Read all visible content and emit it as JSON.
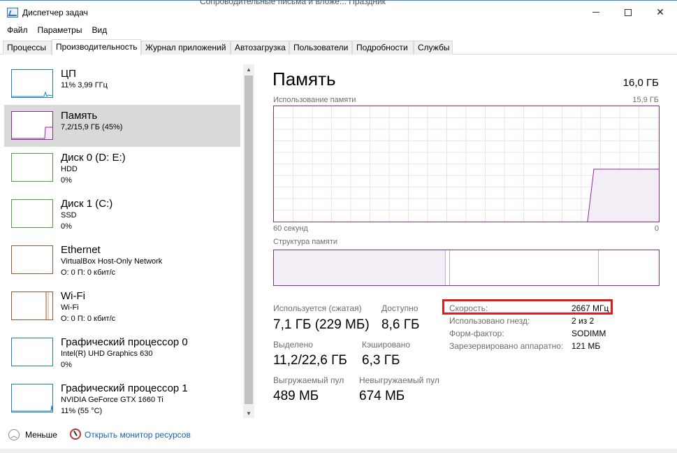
{
  "window": {
    "title": "Диспетчер задач",
    "background_text": "Сопроводительные письма и вложе...   Праздник"
  },
  "menu": [
    "Файл",
    "Параметры",
    "Вид"
  ],
  "tabs": [
    "Процессы",
    "Производительность",
    "Журнал приложений",
    "Автозагрузка",
    "Пользователи",
    "Подробности",
    "Службы"
  ],
  "active_tab": "Производительность",
  "sidebar": {
    "items": [
      {
        "name": "ЦП",
        "line2": "11% 3,99 ГГц",
        "line3": "",
        "color": "#1a7fbf"
      },
      {
        "name": "Память",
        "line2": "7,2/15,9 ГБ (45%)",
        "line3": "",
        "color": "#8b2a9a"
      },
      {
        "name": "Диск 0 (D: E:)",
        "line2": "HDD",
        "line3": "0%",
        "color": "#4aa03f"
      },
      {
        "name": "Диск 1 (C:)",
        "line2": "SSD",
        "line3": "0%",
        "color": "#4aa03f"
      },
      {
        "name": "Ethernet",
        "line2": "VirtualBox Host-Only Network",
        "line3": "О: 0 П: 0 кбит/с",
        "color": "#a0522d"
      },
      {
        "name": "Wi-Fi",
        "line2": "Wi-Fi",
        "line3": "О: 0 П: 0 кбит/с",
        "color": "#a0522d"
      },
      {
        "name": "Графический процессор 0",
        "line2": "Intel(R) UHD Graphics 630",
        "line3": "0%",
        "color": "#1a7fbf"
      },
      {
        "name": "Графический процессор 1",
        "line2": "NVIDIA GeForce GTX 1660 Ti",
        "line3": "11% (55 °C)",
        "color": "#1a7fbf"
      }
    ]
  },
  "main": {
    "title": "Память",
    "total": "16,0 ГБ",
    "usage_label": "Использование памяти",
    "usage_max": "15,9 ГБ",
    "time_left": "60 секунд",
    "time_right": "0",
    "structure_label": "Структура памяти",
    "stats": {
      "in_use_label": "Используется (сжатая)",
      "in_use_value": "7,1 ГБ (229 МБ)",
      "available_label": "Доступно",
      "available_value": "8,6 ГБ",
      "committed_label": "Выделено",
      "committed_value": "11,2/22,6 ГБ",
      "cached_label": "Кэшировано",
      "cached_value": "6,3 ГБ",
      "paged_label": "Выгружаемый пул",
      "paged_value": "489 МБ",
      "nonpaged_label": "Невыгружаемый пул",
      "nonpaged_value": "674 МБ"
    },
    "specs": [
      {
        "label": "Скорость:",
        "value": "2667 МГц"
      },
      {
        "label": "Использовано гнезд:",
        "value": "2 из 2"
      },
      {
        "label": "Форм-фактор:",
        "value": "SODIMM"
      },
      {
        "label": "Зарезервировано аппаратно:",
        "value": "121 МБ"
      }
    ]
  },
  "footer": {
    "less_label": "Меньше",
    "monitor_label": "Открыть монитор ресурсов"
  },
  "colors": {
    "memory": "#8b2a9a",
    "selection": "#d9d9d9",
    "highlight_box": "#e01d1d",
    "link": "#1a5fb4"
  }
}
